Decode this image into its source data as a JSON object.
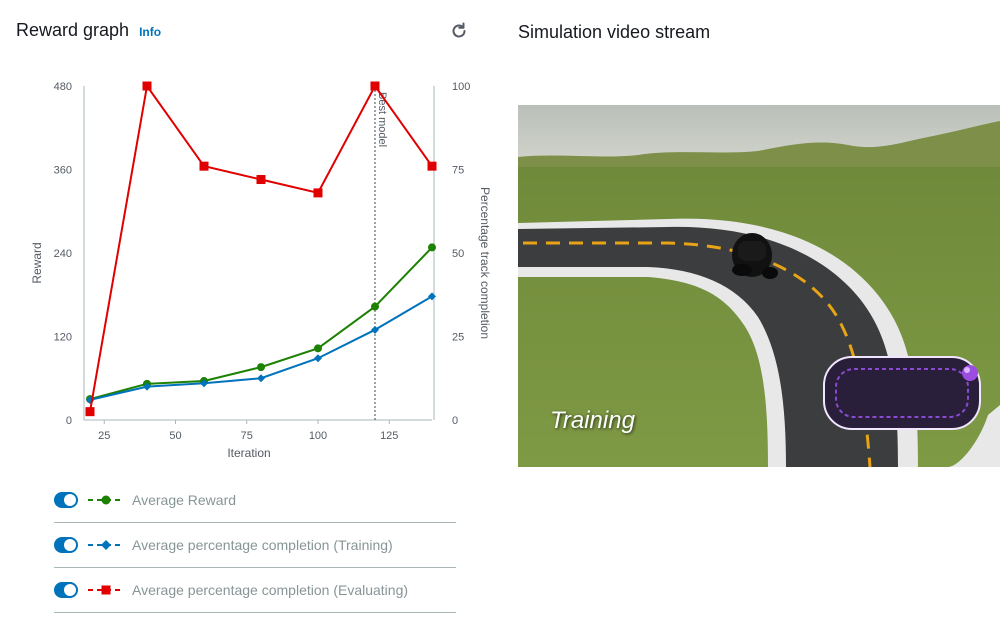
{
  "reward_panel": {
    "title": "Reward graph",
    "info_label": "Info",
    "refresh_icon": "refresh-icon"
  },
  "chart_data": {
    "type": "line",
    "xlabel": "Iteration",
    "ylabel_left": "Reward",
    "ylabel_right": "Percentage track completion",
    "x_ticks": [
      25,
      50,
      75,
      100,
      125
    ],
    "y_left_ticks": [
      0,
      120,
      240,
      360,
      480
    ],
    "y_right_ticks": [
      0,
      25,
      50,
      75,
      100
    ],
    "xlim": [
      20,
      140
    ],
    "ylim_left": [
      0,
      480
    ],
    "ylim_right": [
      0,
      100
    ],
    "best_model": {
      "label": "Best model",
      "x": 120
    },
    "x": [
      20,
      40,
      60,
      80,
      100,
      120,
      140
    ],
    "series": [
      {
        "name": "Average Reward",
        "axis": "left",
        "color": "#1d8102",
        "marker": "circle",
        "values": [
          30,
          52,
          56,
          76,
          103,
          163,
          248
        ]
      },
      {
        "name": "Average percentage completion (Training)",
        "axis": "right",
        "color": "#0073bb",
        "marker": "diamond",
        "values": [
          6,
          10,
          11,
          12.5,
          18.5,
          27,
          37
        ]
      },
      {
        "name": "Average percentage completion (Evaluating)",
        "axis": "right",
        "color": "#e00000",
        "marker": "square",
        "values": [
          2.5,
          100,
          76,
          72,
          68,
          100,
          76
        ]
      }
    ],
    "grid": false,
    "legend": "bottom"
  },
  "legend": [
    {
      "label": "Average Reward",
      "enabled": true,
      "color": "#1d8102",
      "marker": "circle"
    },
    {
      "label": "Average percentage completion (Training)",
      "enabled": true,
      "color": "#0073bb",
      "marker": "diamond"
    },
    {
      "label": "Average percentage completion (Evaluating)",
      "enabled": true,
      "color": "#e00000",
      "marker": "square"
    }
  ],
  "video_panel": {
    "title": "Simulation video stream",
    "overlay_text": "Training"
  }
}
